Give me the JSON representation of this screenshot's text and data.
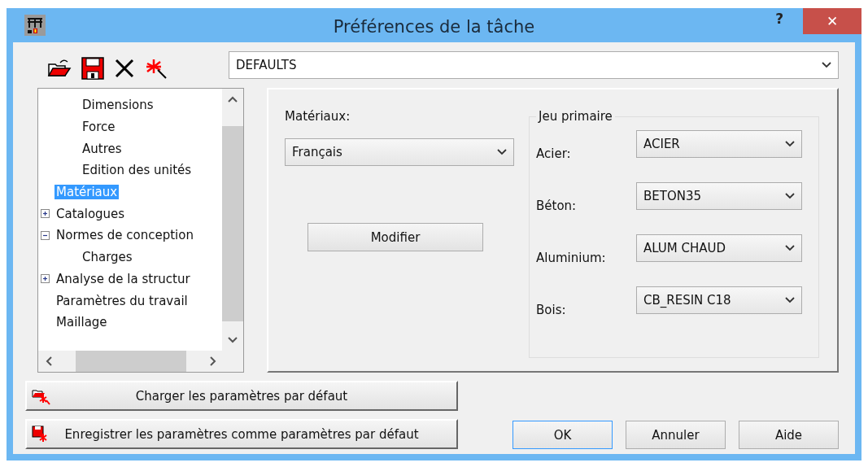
{
  "window": {
    "title": "Préférences de la tâche",
    "help": "?",
    "close": "✕"
  },
  "preset": {
    "value": "DEFAULTS"
  },
  "tree": {
    "items": [
      {
        "children": [
          {
            "label": "Dimensions",
            "selected": false
          },
          {
            "label": "Force",
            "selected": false
          },
          {
            "label": "Autres",
            "selected": false
          },
          {
            "label": "Edition des unités",
            "selected": false
          }
        ]
      },
      {
        "label": "Matériaux",
        "selected": true
      },
      {
        "label": "Catalogues",
        "selected": false,
        "expanded": false
      },
      {
        "label": "Normes de conception",
        "selected": false,
        "expanded": true,
        "children": [
          {
            "label": "Charges",
            "selected": false
          }
        ]
      },
      {
        "label": "Analyse de la structur",
        "selected": false,
        "expanded": false
      },
      {
        "label": "Paramètres du travail",
        "selected": false
      },
      {
        "label": "Maillage",
        "selected": false
      }
    ]
  },
  "materials": {
    "label": "Matériaux:",
    "value": "Français",
    "modify": "Modifier"
  },
  "primary_set": {
    "title": "Jeu primaire",
    "rows": [
      {
        "label": "Acier:",
        "value": "ACIER"
      },
      {
        "label": "Béton:",
        "value": "BETON35"
      },
      {
        "label": "Aluminium:",
        "value": "ALUM CHAUD"
      },
      {
        "label": "Bois:",
        "value": "CB_RESIN C18"
      }
    ]
  },
  "default_buttons": [
    {
      "label": "Charger les paramètres par défaut",
      "kind": "load"
    },
    {
      "label": "Enregistrer les paramètres comme paramètres par défaut",
      "kind": "save"
    }
  ],
  "buttons": [
    {
      "label": "OK",
      "focused": true
    },
    {
      "label": "Annuler",
      "focused": false
    },
    {
      "label": "Aide",
      "focused": false
    }
  ]
}
